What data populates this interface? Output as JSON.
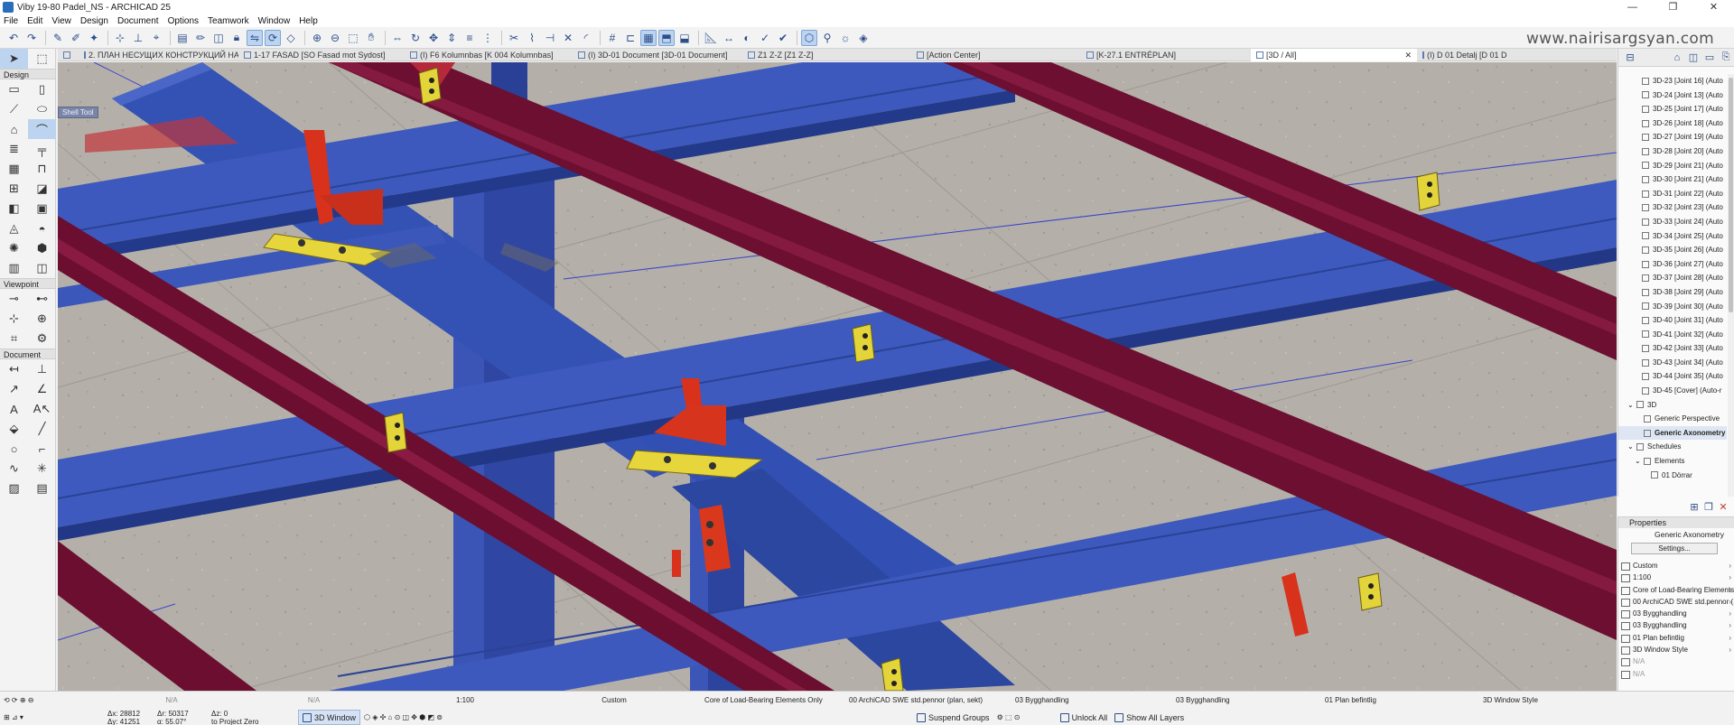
{
  "window": {
    "title": "Viby 19-80 Padel_NS - ARCHICAD 25",
    "controls": [
      "—",
      "❐",
      "✕"
    ]
  },
  "menu": [
    "File",
    "Edit",
    "View",
    "Design",
    "Document",
    "Options",
    "Teamwork",
    "Window",
    "Help"
  ],
  "watermark": "www.nairisargsyan.com",
  "tabs": [
    {
      "label": "2. ПЛАН НЕСУЩИХ КОНСТРУКЦИЙ НА ОТМ...",
      "active": false
    },
    {
      "label": "1-17 FASAD [SO Fasad mot Sydost]",
      "active": false
    },
    {
      "label": "(I) F6 Kolumnbas [K 004 Kolumnbas]",
      "active": false
    },
    {
      "label": "(I) 3D-01 Document [3D-01 Document]",
      "active": false
    },
    {
      "label": "Z1 Z-Z [Z1 Z-Z]",
      "active": false
    },
    {
      "label": "[Action Center]",
      "active": false
    },
    {
      "label": "[K-27.1 ENTRÉPLAN]",
      "active": false
    },
    {
      "label": "[3D / All]",
      "active": true
    },
    {
      "label": "(I) D 01 Detalj [D 01 Detalj]",
      "active": false
    }
  ],
  "toolbox": {
    "sections": [
      "Design",
      "Viewpoint",
      "Document"
    ],
    "tooltip": "Shell Tool"
  },
  "navigator": {
    "items": [
      "3D-23 [Joint 16] (Auto",
      "3D-24 [Joint 13] (Auto",
      "3D-25 [Joint 17] (Auto",
      "3D-26 [Joint 18] (Auto",
      "3D-27 [Joint 19] (Auto",
      "3D-28 [Joint 20] (Auto",
      "3D-29 [Joint 21] (Auto",
      "3D-30 [Joint 21] (Auto",
      "3D-31 [Joint 22] (Auto",
      "3D-32 [Joint 23] (Auto",
      "3D-33 [Joint 24] (Auto",
      "3D-34 [Joint 25] (Auto",
      "3D-35 [Joint 26] (Auto",
      "3D-36 [Joint 27] (Auto",
      "3D-37 [Joint 28] (Auto",
      "3D-38 [Joint 29] (Auto",
      "3D-39 [Joint 30] (Auto",
      "3D-40 [Joint 31] (Auto",
      "3D-41 [Joint 32] (Auto",
      "3D-42 [Joint 33] (Auto",
      "3D-43 [Joint 34] (Auto",
      "3D-44 [Joint 35] (Auto",
      "3D-45 [Cover] (Auto-r",
      "3D",
      "Generic Perspective",
      "Generic Axonometry",
      "Schedules",
      "Elements",
      "01 Dörrar"
    ],
    "selected_index": 25
  },
  "properties": {
    "header": "Properties",
    "name": "Generic Axonometry",
    "settings_label": "Settings...",
    "rows": [
      "Custom",
      "1:100",
      "Core of Load-Bearing Elements ...",
      "00 ArchiCAD SWE std.pennor (...",
      "03 Bygghandling",
      "03 Bygghandling",
      "01 Plan befintlig",
      "3D Window Style",
      "N/A",
      "N/A"
    ]
  },
  "status": {
    "row1": {
      "na1": "N/A",
      "na2": "N/A",
      "scale": "1:100",
      "custom": "Custom",
      "structure": "Core of Load-Bearing Elements Only",
      "pens": "00 ArchiCAD SWE std.pennor (plan, sekt)",
      "layer1": "03 Bygghandling",
      "layer2": "03 Bygghandling",
      "renovation": "01 Plan befintlig",
      "style": "3D Window Style"
    },
    "row2": {
      "dx": "Δx: 28812",
      "dy": "Δy: 41251",
      "dr": "Δr: 50317",
      "angle": "α: 55.07°",
      "z": "Δz: 0",
      "ref": "to Project Zero",
      "window_btn": "3D Window",
      "suspend": "Suspend Groups",
      "unlock": "Unlock All",
      "show_layers": "Show All Layers"
    }
  },
  "colors": {
    "beam_blue": "#3c57b9",
    "beam_maroon": "#6d0f32",
    "plate_yellow": "#e8d83a",
    "stiffener_red": "#d8321c",
    "floor": "#b5b1aa"
  }
}
